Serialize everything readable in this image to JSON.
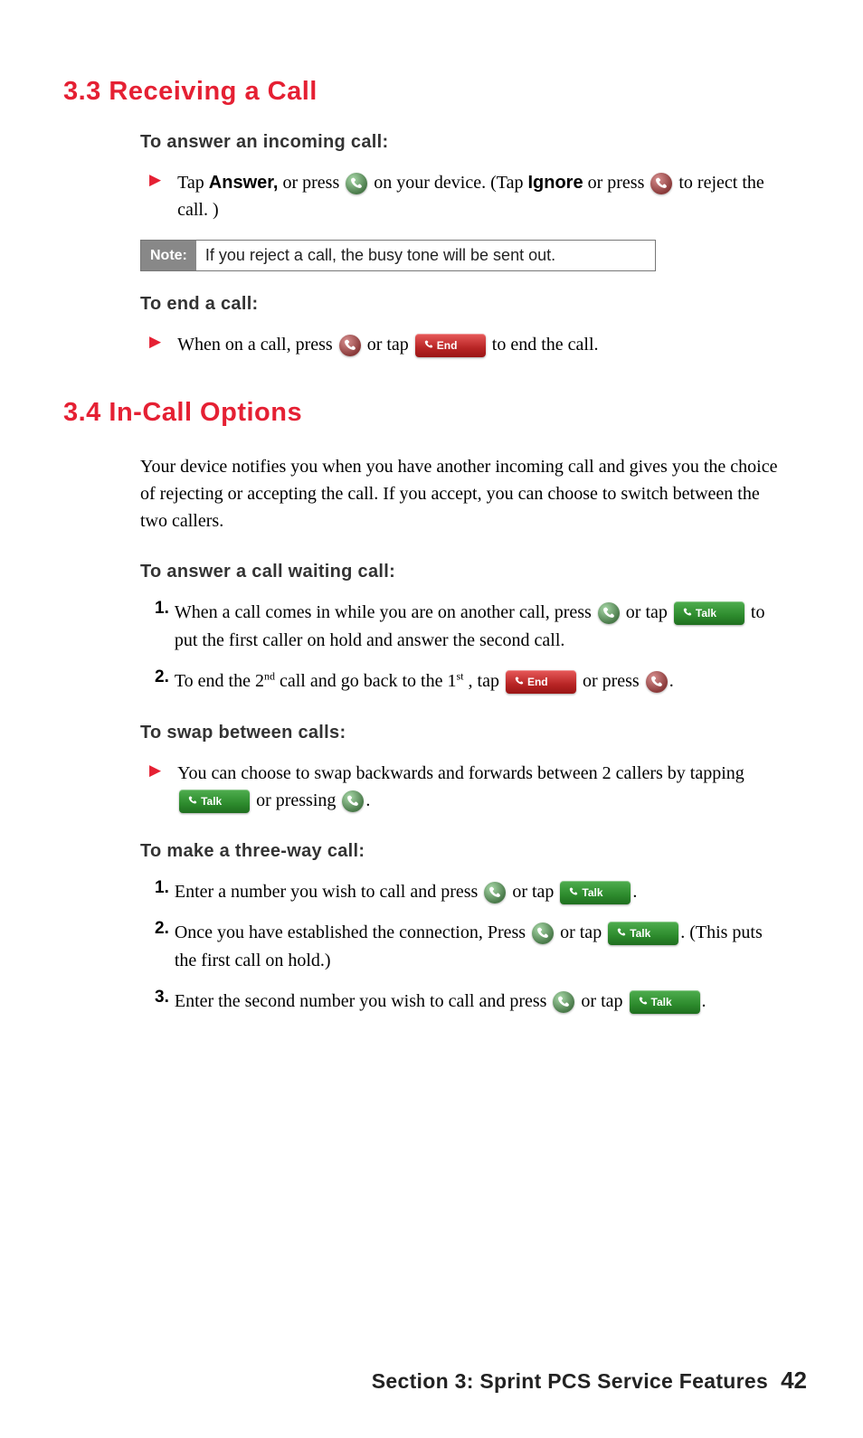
{
  "section33": {
    "num": "3.3",
    "title": "Receiving a Call",
    "h1": "To answer an incoming call:",
    "b1_a": "Tap ",
    "b1_b": "Answer,",
    "b1_c": " or press ",
    "b1_d": " on your device. (Tap ",
    "b1_e": "Ignore",
    "b1_f": " or press ",
    "b1_g": " to reject the call. )",
    "note_label": "Note:",
    "note_text": "If you reject a call, the busy tone will be sent out.",
    "h2": "To end a call:",
    "b2_a": "When on a call, press ",
    "b2_b": " or tap ",
    "b2_c": " to end the call."
  },
  "section34": {
    "num": "3.4",
    "title": "In-Call Options",
    "para": "Your device notifies you when you have another incoming call and gives you the choice of rejecting or accepting the call. If you accept, you can choose to switch between the two callers.",
    "hA": "To answer a call waiting call:",
    "a1_a": "When a call comes in while you are on another call, press ",
    "a1_b": " or tap ",
    "a1_c": " to put the first caller on hold and answer the second call.",
    "a2_a": "To end the 2",
    "a2_sup1": "nd",
    "a2_b": " call and go back to the 1",
    "a2_sup2": "st",
    "a2_c": ", tap ",
    "a2_d": " or press ",
    "a2_e": ".",
    "hB": "To swap between calls:",
    "b1_a": "You can choose to swap backwards and forwards between 2 callers by tapping ",
    "b1_b": " or pressing ",
    "b1_c": ".",
    "hC": "To make a three-way call:",
    "c1_a": "Enter a number you wish to call and press ",
    "c1_b": " or tap ",
    "c1_c": ".",
    "c2_a": "Once you have established the connection, Press ",
    "c2_b": " or tap ",
    "c2_c": ". (This puts the first call on hold.)",
    "c3_a": "Enter the second number you wish to call and press ",
    "c3_b": " or tap ",
    "c3_c": "."
  },
  "nums": {
    "n1": "1.",
    "n2": "2.",
    "n3": "3."
  },
  "btn": {
    "end": "End",
    "talk": "Talk"
  },
  "footer": {
    "title": "Section 3: Sprint PCS Service Features",
    "page": "42"
  }
}
